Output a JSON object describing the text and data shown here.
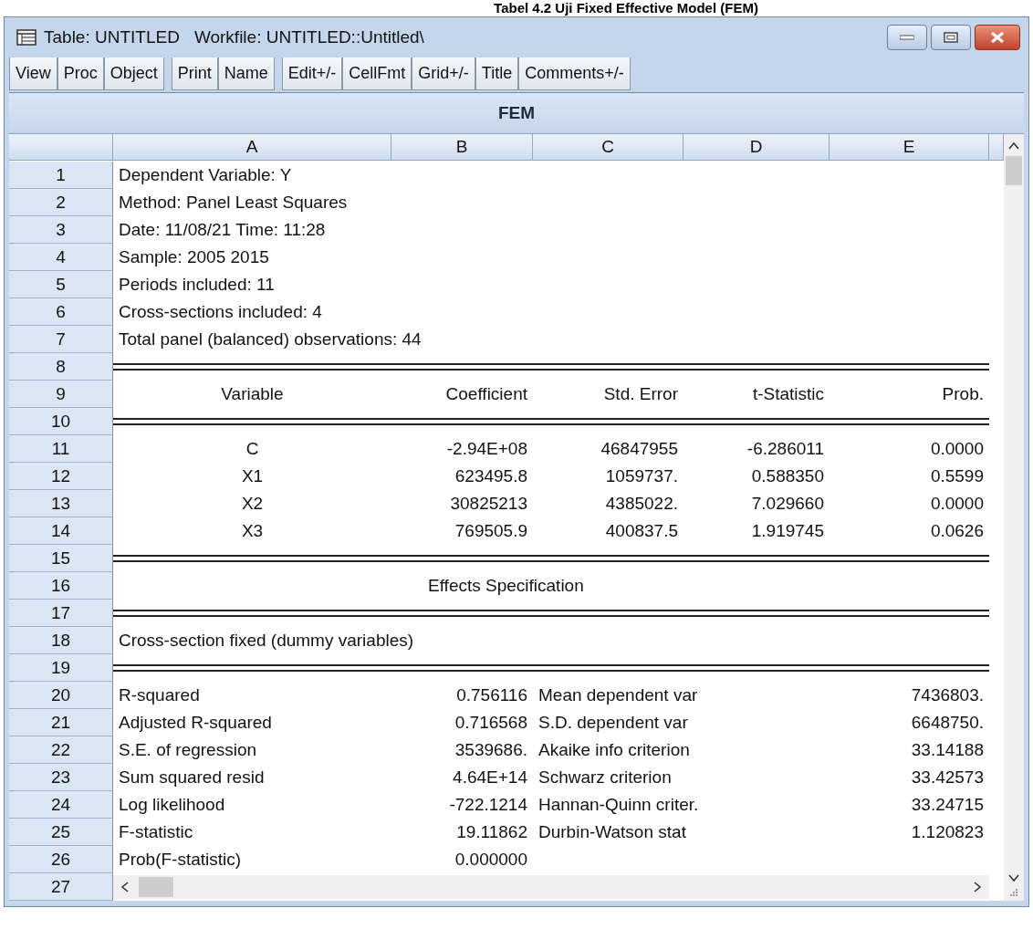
{
  "caption": "Tabel 4.2 Uji Fixed Effective Model (FEM)",
  "window": {
    "title": "Table: UNTITLED",
    "subtitle": "Workfile: UNTITLED::Untitled\\"
  },
  "toolbar": [
    [
      "View",
      "Proc",
      "Object"
    ],
    [
      "Print",
      "Name"
    ],
    [
      "Edit+/-",
      "CellFmt",
      "Grid+/-",
      "Title",
      "Comments+/-"
    ]
  ],
  "table": {
    "title": "FEM",
    "columns": [
      "A",
      "B",
      "C",
      "D",
      "E"
    ],
    "rows": [
      {
        "number": "1",
        "kind": "text",
        "cells": [
          "Dependent Variable: Y"
        ]
      },
      {
        "number": "2",
        "kind": "text",
        "cells": [
          "Method: Panel Least Squares"
        ]
      },
      {
        "number": "3",
        "kind": "text",
        "cells": [
          "Date: 11/08/21   Time: 11:28"
        ]
      },
      {
        "number": "4",
        "kind": "text",
        "cells": [
          "Sample: 2005 2015"
        ]
      },
      {
        "number": "5",
        "kind": "text",
        "cells": [
          "Periods included: 11"
        ]
      },
      {
        "number": "6",
        "kind": "text",
        "cells": [
          "Cross-sections included: 4"
        ]
      },
      {
        "number": "7",
        "kind": "text",
        "cells": [
          "Total panel (balanced) observations: 44"
        ]
      },
      {
        "number": "8",
        "kind": "rule",
        "cells": []
      },
      {
        "number": "9",
        "kind": "coef",
        "cells": [
          "Variable",
          "Coefficient",
          "Std. Error",
          "t-Statistic",
          "Prob."
        ]
      },
      {
        "number": "10",
        "kind": "rule",
        "cells": []
      },
      {
        "number": "11",
        "kind": "coef",
        "cells": [
          "C",
          "-2.94E+08",
          "46847955",
          "-6.286011",
          "0.0000"
        ]
      },
      {
        "number": "12",
        "kind": "coef",
        "cells": [
          "X1",
          "623495.8",
          "1059737.",
          "0.588350",
          "0.5599"
        ]
      },
      {
        "number": "13",
        "kind": "coef",
        "cells": [
          "X2",
          "30825213",
          "4385022.",
          "7.029660",
          "0.0000"
        ]
      },
      {
        "number": "14",
        "kind": "coef",
        "cells": [
          "X3",
          "769505.9",
          "400837.5",
          "1.919745",
          "0.0626"
        ]
      },
      {
        "number": "15",
        "kind": "rule",
        "cells": []
      },
      {
        "number": "16",
        "kind": "title",
        "cells": [
          "",
          "Effects Specification"
        ]
      },
      {
        "number": "17",
        "kind": "rule",
        "cells": []
      },
      {
        "number": "18",
        "kind": "text",
        "cells": [
          "Cross-section fixed (dummy variables)"
        ]
      },
      {
        "number": "19",
        "kind": "rule",
        "cells": []
      },
      {
        "number": "20",
        "kind": "stats",
        "cells": [
          "R-squared",
          "0.756116",
          "Mean dependent var",
          "7436803."
        ]
      },
      {
        "number": "21",
        "kind": "stats",
        "cells": [
          "Adjusted R-squared",
          "0.716568",
          "S.D. dependent var",
          "6648750."
        ]
      },
      {
        "number": "22",
        "kind": "stats",
        "cells": [
          "S.E. of regression",
          "3539686.",
          "Akaike info criterion",
          "33.14188"
        ]
      },
      {
        "number": "23",
        "kind": "stats",
        "cells": [
          "Sum squared resid",
          "4.64E+14",
          "Schwarz criterion",
          "33.42573"
        ]
      },
      {
        "number": "24",
        "kind": "stats",
        "cells": [
          "Log likelihood",
          "-722.1214",
          "Hannan-Quinn criter.",
          "33.24715"
        ]
      },
      {
        "number": "25",
        "kind": "stats",
        "cells": [
          "F-statistic",
          "19.11862",
          "Durbin-Watson stat",
          "1.120823"
        ]
      },
      {
        "number": "26",
        "kind": "stats",
        "cells": [
          "Prob(F-statistic)",
          "0.000000"
        ]
      },
      {
        "number": "27",
        "kind": "hscroll",
        "cells": []
      }
    ]
  }
}
